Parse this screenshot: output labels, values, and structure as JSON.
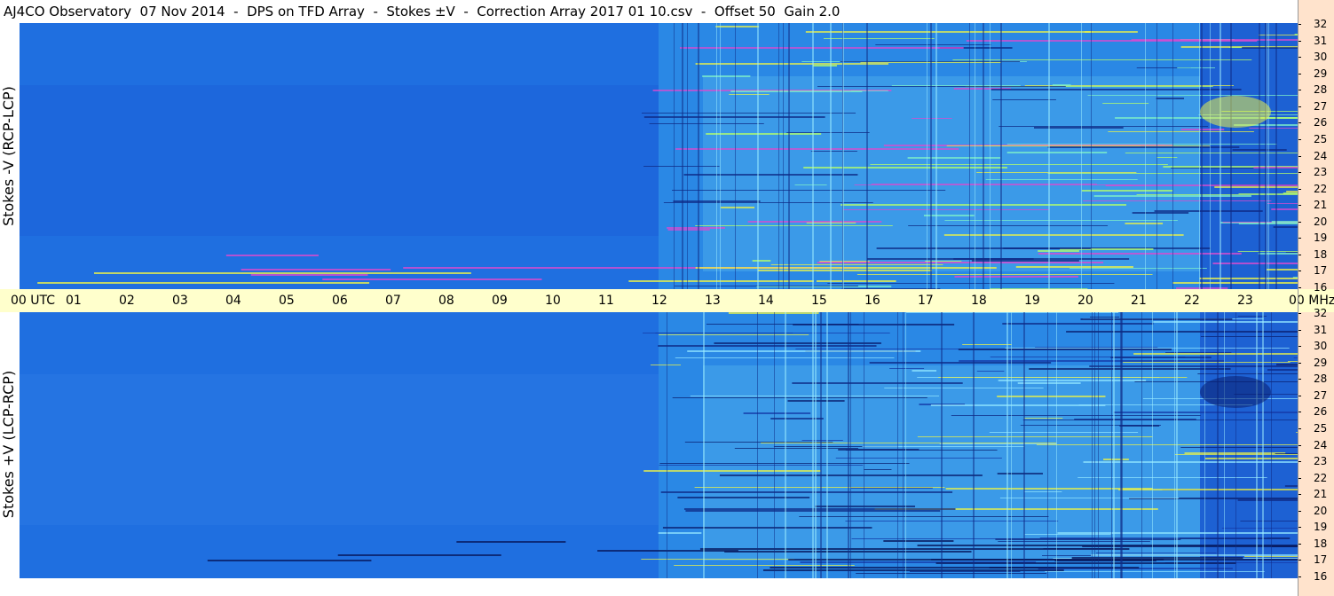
{
  "title": "AJ4CO Observatory  07 Nov 2014  -  DPS on TFD Array  -  Stokes ±V  -  Correction Array 2017 01 10.csv  -  Offset 50  Gain 2.0",
  "panels": {
    "top_label": "Stokes -V (RCP-LCP)",
    "bottom_label": "Stokes +V (LCP-RCP)"
  },
  "time_axis": {
    "start_label": "00 UTC",
    "end_label": "00 MHz",
    "hours": [
      "01",
      "02",
      "03",
      "04",
      "05",
      "06",
      "07",
      "08",
      "09",
      "10",
      "11",
      "12",
      "13",
      "14",
      "15",
      "16",
      "17",
      "18",
      "19",
      "20",
      "21",
      "22",
      "23"
    ]
  },
  "freq_axis": {
    "labels": [
      "32",
      "31",
      "30",
      "29",
      "28",
      "27",
      "26",
      "25",
      "24",
      "23",
      "22",
      "21",
      "20",
      "19",
      "18",
      "17",
      "16"
    ]
  },
  "colors": {
    "background_blue": "#1f6fe0",
    "deep_blue": "#1a4fc4",
    "cyan": "#3fb7ee",
    "yellow": "#e8f04a",
    "magenta": "#d84bd0",
    "time_axis_bg": "#ffffcc",
    "freq_axis_bg": "#ffe3cc"
  }
}
